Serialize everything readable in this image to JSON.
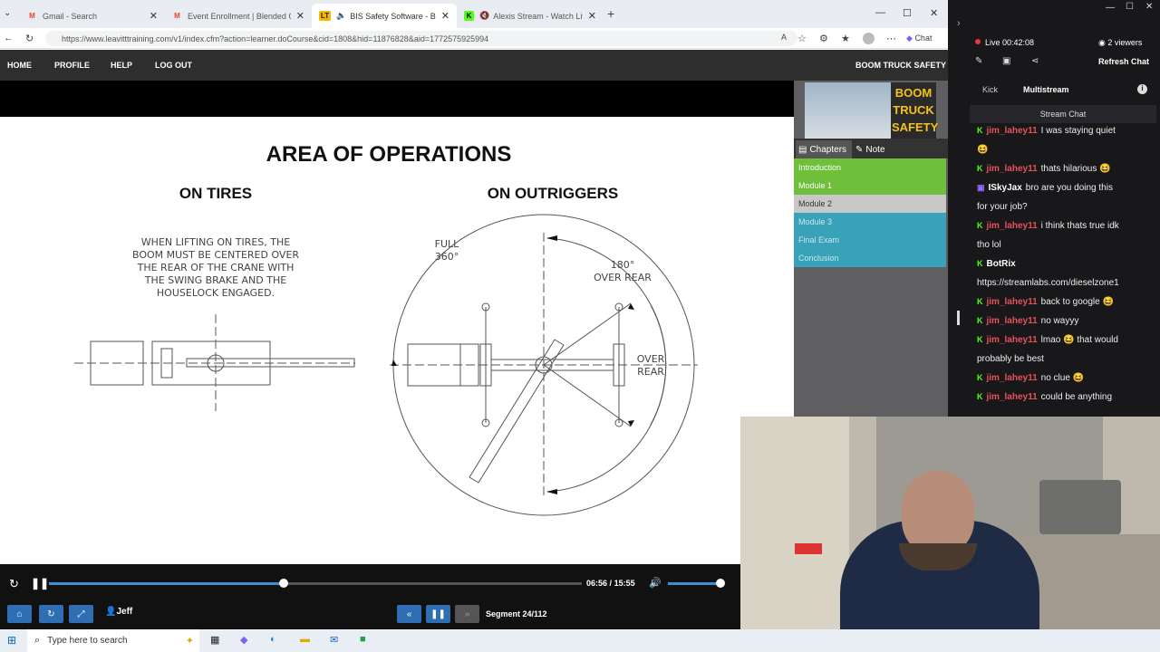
{
  "browser": {
    "tabs": [
      {
        "title": "Gmail - Search",
        "fav": "M",
        "color": "#ea4335"
      },
      {
        "title": "Event Enrollment | Blended Online",
        "fav": "M",
        "color": "#ea4335"
      },
      {
        "title": "BIS Safety Software - Boom Tr",
        "fav": "LT",
        "color": "#f5b800"
      },
      {
        "title": "Alexis Stream - Watch Live on",
        "fav": "K",
        "color": "#53fc18"
      }
    ],
    "url": "https://www.leavitttraining.com/v1/index.cfm?action=learner.doCourse&cid=1808&hid=11876828&aid=1772575925994",
    "copilot_label": "Chat"
  },
  "site_nav": {
    "links": [
      "HOME",
      "PROFILE",
      "HELP",
      "LOG OUT"
    ],
    "course_title": "BOOM TRUCK SAFETY"
  },
  "slide": {
    "title": "AREA OF OPERATIONS",
    "left_heading": "ON TIRES",
    "right_heading": "ON OUTRIGGERS",
    "note_lines": [
      "WHEN LIFTING ON TIRES, THE",
      "BOOM MUST BE CENTERED OVER",
      "THE REAR OF THE CRANE WITH",
      "THE SWING BRAKE AND THE",
      "HOUSELOCK ENGAGED."
    ],
    "full_label": [
      "FULL",
      "360°"
    ],
    "rear_label": [
      "180°",
      "OVER REAR"
    ],
    "over_rear_label": [
      "OVER",
      "REAR"
    ]
  },
  "sidebar": {
    "logo_text": [
      "BOOM",
      "TRUCK",
      "SAFETY"
    ],
    "chapters_tab": "Chapters",
    "note_tab": "Note",
    "chapters": [
      {
        "label": "Introduction",
        "bg": "#6fbf3a",
        "color": "#ffffff"
      },
      {
        "label": "Module 1",
        "bg": "#6fbf3a",
        "color": "#ffffff"
      },
      {
        "label": "Module 2",
        "bg": "#c8c8c8",
        "color": "#333333"
      },
      {
        "label": "Module 3",
        "bg": "#3aa2b8",
        "color": "#c9e7ee"
      },
      {
        "label": "Final Exam",
        "bg": "#3aa2b8",
        "color": "#c9e7ee"
      },
      {
        "label": "Conclusion",
        "bg": "#3aa2b8",
        "color": "#c9e7ee"
      }
    ]
  },
  "player": {
    "current_time": "06:56",
    "sep": "/",
    "total_time": "15:55",
    "progress": 0.44,
    "volume": 1.0,
    "user": "Jeff",
    "segment": "Segment 24/112"
  },
  "stream": {
    "live_label": "Live",
    "duration": "00:42:08",
    "viewers": "2 viewers",
    "refresh_label": "Refresh Chat",
    "tabs": [
      "Kick",
      "Multistream"
    ],
    "chat_header": "Stream Chat",
    "messages": [
      {
        "user": "jim_lahey11",
        "text": "I was staying quiet",
        "cont": "😆"
      },
      {
        "user": "jim_lahey11",
        "text": "thats hilarious 😆"
      },
      {
        "user": "ISkyJax",
        "text": "bro are you doing this",
        "cont": "for your job?"
      },
      {
        "user": "jim_lahey11",
        "text": "i think thats true idk",
        "cont": "tho lol"
      },
      {
        "user": "BotRix",
        "text": "",
        "cont": "https://streamlabs.com/dieselzone1"
      },
      {
        "user": "jim_lahey11",
        "text": "back to google 😆"
      },
      {
        "user": "jim_lahey11",
        "text": "no wayyy"
      },
      {
        "user": "jim_lahey11",
        "text": "lmao 😆 that would",
        "cont": "probably be best"
      },
      {
        "user": "jim_lahey11",
        "text": "no clue 😆"
      },
      {
        "user": "jim_lahey11",
        "text": "could be anything"
      }
    ]
  },
  "taskbar": {
    "search_placeholder": "Type here to search"
  }
}
